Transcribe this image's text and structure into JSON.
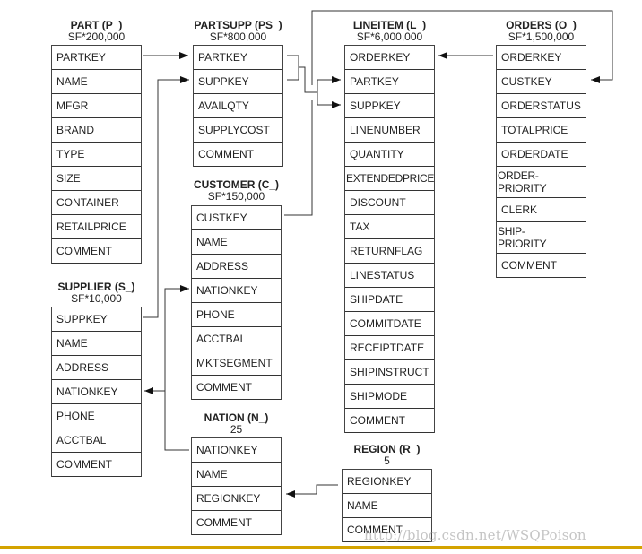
{
  "tables": [
    {
      "id": "part",
      "name": "PART (P_)",
      "size": "SF*200,000",
      "columns": [
        "PARTKEY",
        "NAME",
        "MFGR",
        "BRAND",
        "TYPE",
        "SIZE",
        "CONTAINER",
        "RETAILPRICE",
        "COMMENT"
      ]
    },
    {
      "id": "partsupp",
      "name": "PARTSUPP (PS_)",
      "size": "SF*800,000",
      "columns": [
        "PARTKEY",
        "SUPPKEY",
        "AVAILQTY",
        "SUPPLYCOST",
        "COMMENT"
      ]
    },
    {
      "id": "customer",
      "name": "CUSTOMER (C_)",
      "size": "SF*150,000",
      "columns": [
        "CUSTKEY",
        "NAME",
        "ADDRESS",
        "NATIONKEY",
        "PHONE",
        "ACCTBAL",
        "MKTSEGMENT",
        "COMMENT"
      ]
    },
    {
      "id": "supplier",
      "name": "SUPPLIER (S_)",
      "size": "SF*10,000",
      "columns": [
        "SUPPKEY",
        "NAME",
        "ADDRESS",
        "NATIONKEY",
        "PHONE",
        "ACCTBAL",
        "COMMENT"
      ]
    },
    {
      "id": "nation",
      "name": "NATION (N_)",
      "size": "25",
      "columns": [
        "NATIONKEY",
        "NAME",
        "REGIONKEY",
        "COMMENT"
      ]
    },
    {
      "id": "region",
      "name": "REGION (R_)",
      "size": "5",
      "columns": [
        "REGIONKEY",
        "NAME",
        "COMMENT"
      ]
    },
    {
      "id": "lineitem",
      "name": "LINEITEM (L_)",
      "size": "SF*6,000,000",
      "columns": [
        "ORDERKEY",
        "PARTKEY",
        "SUPPKEY",
        "LINENUMBER",
        "QUANTITY",
        "EXTENDEDPRICE",
        "DISCOUNT",
        "TAX",
        "RETURNFLAG",
        "LINESTATUS",
        "SHIPDATE",
        "COMMITDATE",
        "RECEIPTDATE",
        "SHIPINSTRUCT",
        "SHIPMODE",
        "COMMENT"
      ]
    },
    {
      "id": "orders",
      "name": "ORDERS (O_)",
      "size": "SF*1,500,000",
      "columns": [
        "ORDERKEY",
        "CUSTKEY",
        "ORDERSTATUS",
        "TOTALPRICE",
        "ORDERDATE",
        "ORDER-\nPRIORITY",
        "CLERK",
        "SHIP-\nPRIORITY",
        "COMMENT"
      ]
    }
  ],
  "relationships": [
    {
      "from": "PART.PARTKEY",
      "to": "PARTSUPP.PARTKEY"
    },
    {
      "from": "SUPPLIER.SUPPKEY",
      "to": "PARTSUPP.SUPPKEY"
    },
    {
      "from": "PARTSUPP.PARTKEY+SUPPKEY",
      "to": "LINEITEM.PARTKEY+SUPPKEY"
    },
    {
      "from": "ORDERS.ORDERKEY",
      "to": "LINEITEM.ORDERKEY"
    },
    {
      "from": "CUSTOMER.CUSTKEY",
      "to": "ORDERS.CUSTKEY"
    },
    {
      "from": "NATION.NATIONKEY",
      "to": "CUSTOMER.NATIONKEY"
    },
    {
      "from": "NATION.NATIONKEY",
      "to": "SUPPLIER.NATIONKEY"
    },
    {
      "from": "REGION.REGIONKEY",
      "to": "NATION.REGIONKEY"
    }
  ],
  "watermark": "http://blog.csdn.net/WSQPoison",
  "colors": {
    "line": "#333333",
    "bottom_rule": "#d4a300"
  }
}
